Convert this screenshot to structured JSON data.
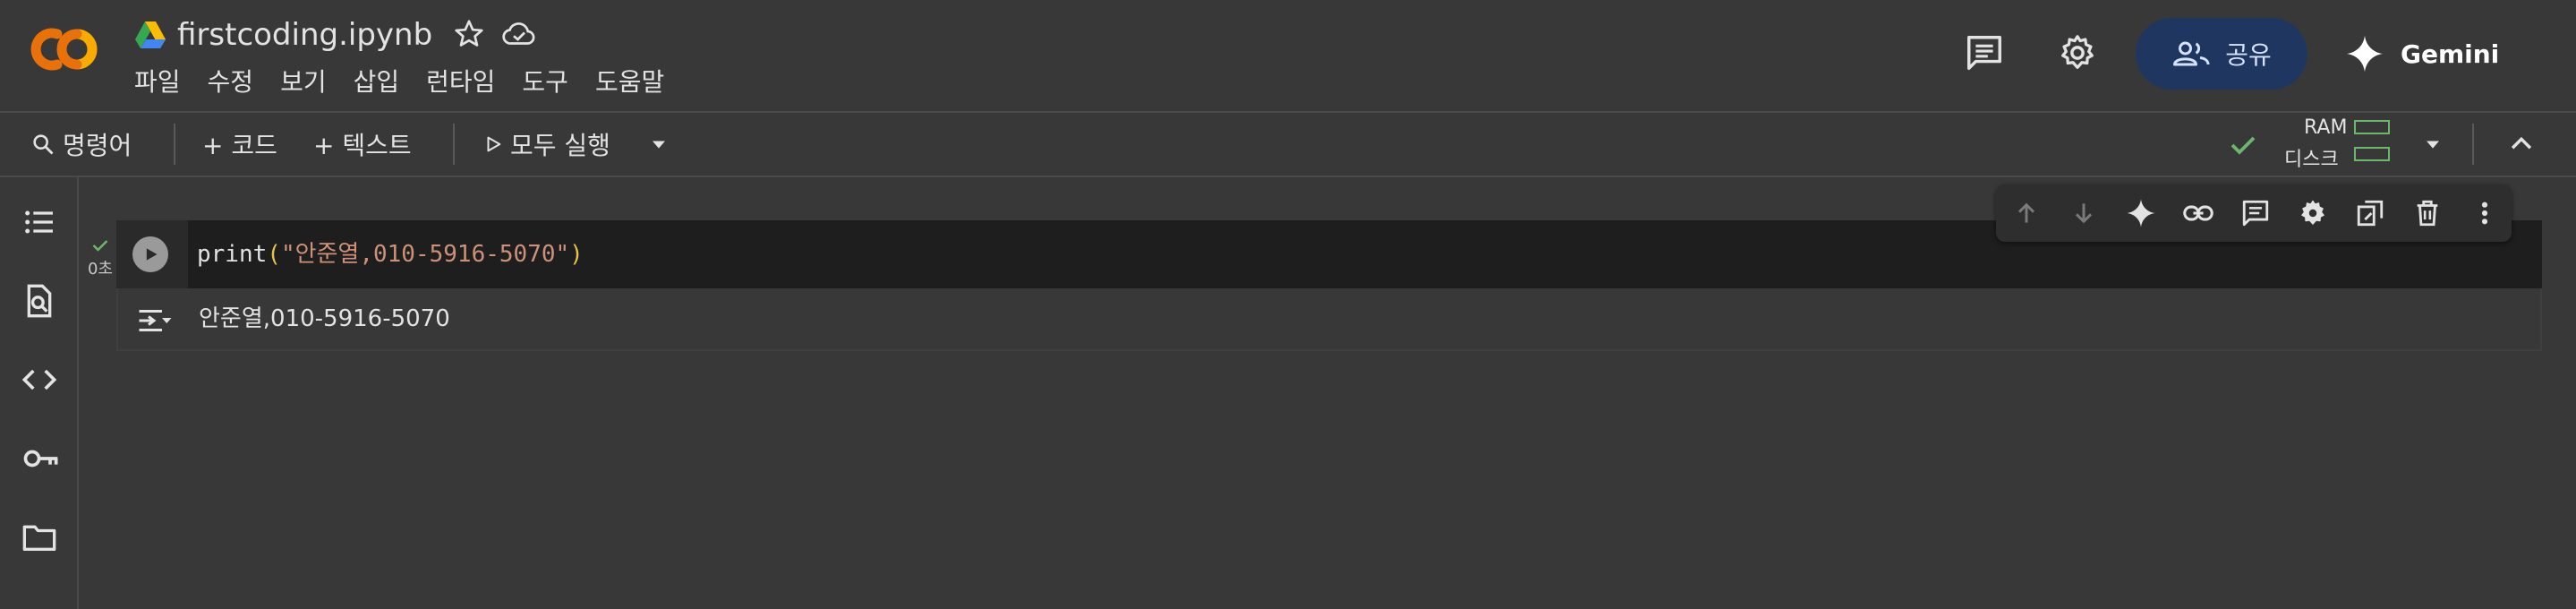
{
  "header": {
    "file_title": "firstcoding.ipynb",
    "menu": [
      "파일",
      "수정",
      "보기",
      "삽입",
      "런타임",
      "도구",
      "도움말"
    ],
    "share_label": "공유",
    "gemini_label": "Gemini"
  },
  "toolbar": {
    "command_label": "명령어",
    "add_code_label": "+ 코드",
    "add_text_label": "+ 텍스트",
    "run_all_label": "모두 실행",
    "ram_label": "RAM",
    "disk_label": "디스크"
  },
  "cell": {
    "code_fn": "print",
    "code_open": "(",
    "code_string": "\"안준열,010-5916-5070\"",
    "code_close": ")",
    "output": "안준열,010-5916-5070",
    "exec_time": "0초"
  },
  "icons": {
    "left_rail": [
      "table-of-contents-icon",
      "find-replace-icon",
      "code-snippets-icon",
      "secrets-key-icon",
      "files-folder-icon"
    ],
    "cell_toolbar": [
      "move-up-icon",
      "move-down-icon",
      "gemini-sparkle-icon",
      "link-icon",
      "comment-icon",
      "settings-icon",
      "mirror-cell-icon",
      "delete-icon",
      "more-vert-icon"
    ]
  },
  "colors": {
    "background": "#383838",
    "code_background": "#1e1e1e",
    "share_button": "#1f3760",
    "logo_orange": "#f9ab00",
    "logo_dark_orange": "#e8710a",
    "status_green": "#6bb86b",
    "string_color": "#ce9178",
    "paren_color": "#e8c34a"
  }
}
